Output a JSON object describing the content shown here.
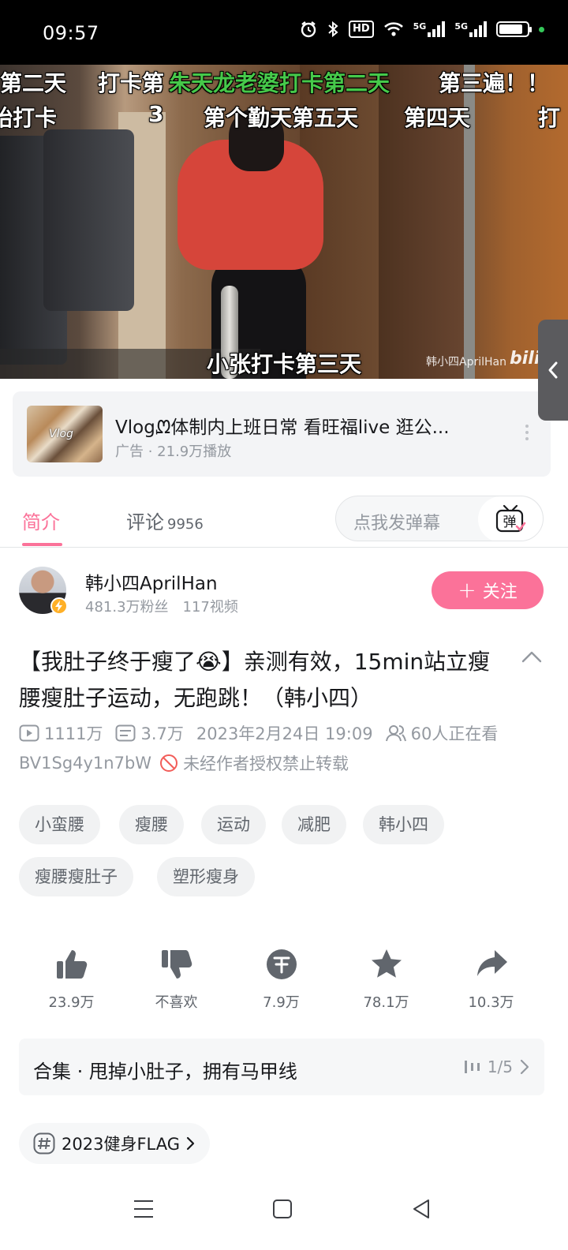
{
  "status_bar": {
    "time": "09:57",
    "hd_label": "HD",
    "net_label_1": "5G",
    "net_label_2": "5G",
    "battery_level": 0.85
  },
  "video": {
    "danmaku": [
      {
        "text": "第二天",
        "color": "#ffffff"
      },
      {
        "text": "打卡第",
        "color": "#ffffff"
      },
      {
        "text": "朱天龙老婆打卡第二天",
        "color": "#46c94a"
      },
      {
        "text": "第三遍！！",
        "color": "#ffffff"
      },
      {
        "text": "始打卡",
        "color": "#ffffff"
      },
      {
        "text": "3",
        "color": "#ffffff"
      },
      {
        "text": "第个勤天第五天",
        "color": "#ffffff"
      },
      {
        "text": "第四天",
        "color": "#ffffff"
      },
      {
        "text": "打",
        "color": "#ffffff"
      }
    ],
    "subtitle": "小张打卡第三天",
    "watermark": "韩小四AprilHan",
    "watermark_logo": "bili"
  },
  "ad": {
    "thumb_text": "Vlog",
    "title": "Vlog⁠ᘻ体制内上班日常 看旺福live 逛公...",
    "meta": "广告 · 21.9万播放"
  },
  "tabs": {
    "intro": "简介",
    "comments": "评论",
    "comments_count": "9956",
    "danmu_placeholder": "点我发弹幕",
    "danmu_button": "弹"
  },
  "uploader": {
    "name": "韩小四AprilHan",
    "fans": "481.3万粉丝",
    "videos": "117视频",
    "follow_label": "关注"
  },
  "video_info": {
    "title": "【我肚子终于瘦了😭】亲测有效，15min站立瘦腰瘦肚子运动，无跑跳！（韩小四）",
    "views": "1111万",
    "danmaku_count": "3.7万",
    "publish_time": "2023年2月24日 19:09",
    "watching": "60人正在看",
    "bvid": "BV1Sg4y1n7bW",
    "copyright": "未经作者授权禁止转载"
  },
  "tags": [
    "小蛮腰",
    "瘦腰",
    "运动",
    "减肥",
    "韩小四",
    "瘦腰瘦肚子",
    "塑形瘦身"
  ],
  "actions": {
    "like": "23.9万",
    "dislike": "不喜欢",
    "coin": "7.9万",
    "favorite": "78.1万",
    "share": "10.3万"
  },
  "collection": {
    "title": "合集 · 甩掉小肚子，拥有马甲线",
    "progress": "1/5"
  },
  "topic_tag": "2023健身FLAG",
  "colors": {
    "accent": "#fb7299",
    "text_secondary": "#9499a0",
    "danmaku_green": "#46c94a"
  }
}
